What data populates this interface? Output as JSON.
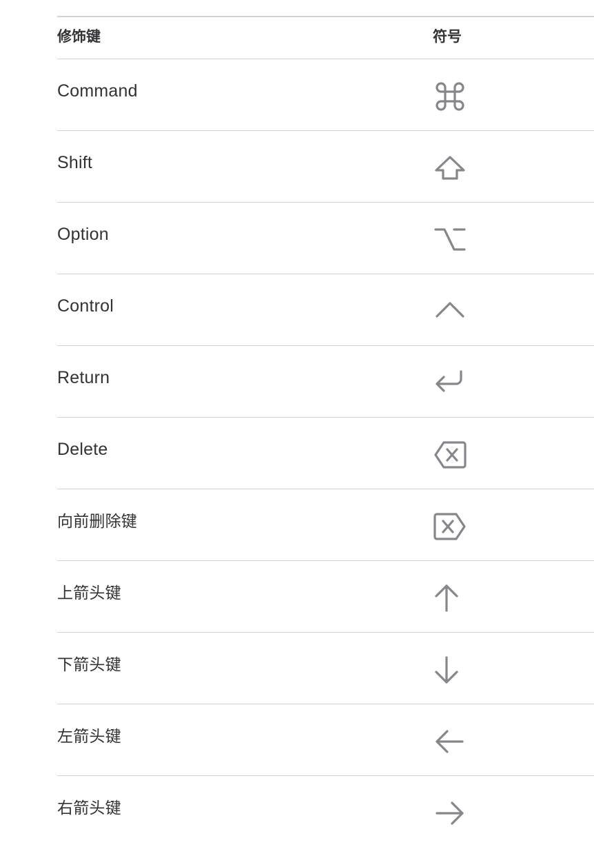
{
  "table": {
    "header": {
      "modifier_key": "修饰键",
      "symbol": "符号"
    },
    "rows": [
      {
        "label": "Command",
        "icon": "command-icon"
      },
      {
        "label": "Shift",
        "icon": "shift-icon"
      },
      {
        "label": "Option",
        "icon": "option-icon"
      },
      {
        "label": "Control",
        "icon": "control-icon"
      },
      {
        "label": "Return",
        "icon": "return-icon"
      },
      {
        "label": "Delete",
        "icon": "delete-icon"
      },
      {
        "label": "向前删除键",
        "icon": "forward-delete-icon"
      },
      {
        "label": "上箭头键",
        "icon": "up-arrow-icon"
      },
      {
        "label": "下箭头键",
        "icon": "down-arrow-icon"
      },
      {
        "label": "左箭头键",
        "icon": "left-arrow-icon"
      },
      {
        "label": "右箭头键",
        "icon": "right-arrow-icon"
      }
    ]
  },
  "colors": {
    "text": "#333336",
    "symbol": "#86868b",
    "divider": "#d2d2d7"
  }
}
